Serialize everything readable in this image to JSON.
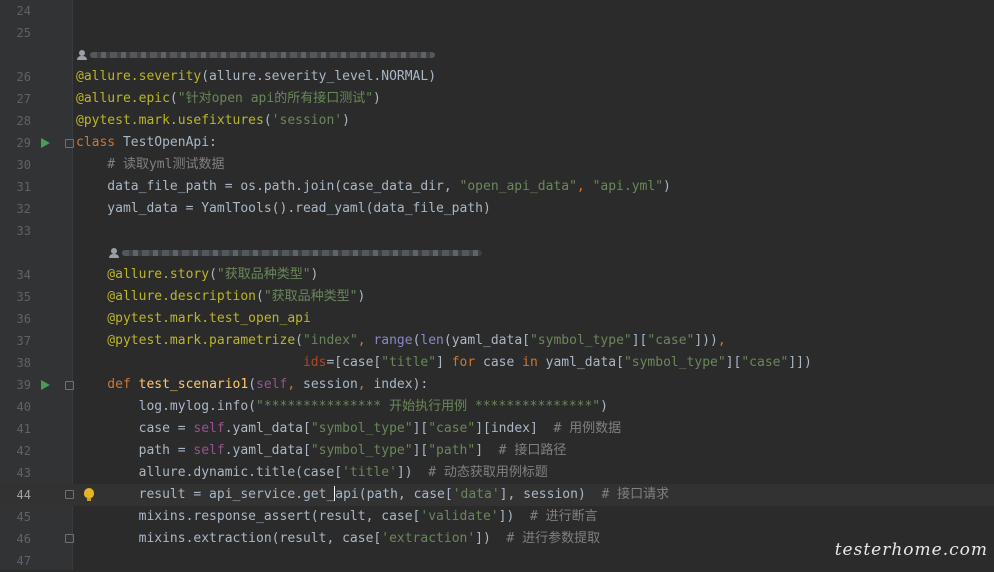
{
  "editor": {
    "lines": [
      {
        "num": "24",
        "tokens": []
      },
      {
        "num": "25",
        "tokens": []
      },
      {
        "num": "26",
        "tokens": [
          {
            "t": "@allure.severity",
            "c": "#bbb529"
          },
          {
            "t": "(allure.severity_level.NORMAL)",
            "c": "#a9b7c6"
          }
        ]
      },
      {
        "num": "27",
        "tokens": [
          {
            "t": "@allure.epic",
            "c": "#bbb529"
          },
          {
            "t": "(",
            "c": "#a9b7c6"
          },
          {
            "t": "\"针对open api的所有接口测试\"",
            "c": "#6a8759"
          },
          {
            "t": ")",
            "c": "#a9b7c6"
          }
        ]
      },
      {
        "num": "28",
        "tokens": [
          {
            "t": "@pytest.mark.usefixtures",
            "c": "#bbb529"
          },
          {
            "t": "(",
            "c": "#a9b7c6"
          },
          {
            "t": "'session'",
            "c": "#6a8759"
          },
          {
            "t": ")",
            "c": "#a9b7c6"
          }
        ]
      },
      {
        "num": "29",
        "tokens": [
          {
            "t": "class ",
            "c": "#cc7832"
          },
          {
            "t": "TestOpenApi:",
            "c": "#a9b7c6"
          }
        ]
      },
      {
        "num": "30",
        "tokens": [
          {
            "t": "    # 读取yml测试数据",
            "c": "#808080"
          }
        ]
      },
      {
        "num": "31",
        "tokens": [
          {
            "t": "    data_file_path = os.path.join(case_data_dir, ",
            "c": "#a9b7c6"
          },
          {
            "t": "\"open_api_data\"",
            "c": "#6a8759"
          },
          {
            "t": ", ",
            "c": "#cc7832"
          },
          {
            "t": "\"api.yml\"",
            "c": "#6a8759"
          },
          {
            "t": ")",
            "c": "#a9b7c6"
          }
        ]
      },
      {
        "num": "32",
        "tokens": [
          {
            "t": "    yaml_data = YamlTools().read_yaml(data_file_path)",
            "c": "#a9b7c6"
          }
        ]
      },
      {
        "num": "33",
        "tokens": []
      },
      {
        "num": "34",
        "tokens": [
          {
            "t": "    @allure.story",
            "c": "#bbb529"
          },
          {
            "t": "(",
            "c": "#a9b7c6"
          },
          {
            "t": "\"获取品种类型\"",
            "c": "#6a8759"
          },
          {
            "t": ")",
            "c": "#a9b7c6"
          }
        ]
      },
      {
        "num": "35",
        "tokens": [
          {
            "t": "    @allure.description",
            "c": "#bbb529"
          },
          {
            "t": "(",
            "c": "#a9b7c6"
          },
          {
            "t": "\"获取品种类型\"",
            "c": "#6a8759"
          },
          {
            "t": ")",
            "c": "#a9b7c6"
          }
        ]
      },
      {
        "num": "36",
        "tokens": [
          {
            "t": "    @pytest.mark.test_open_api",
            "c": "#bbb529"
          }
        ]
      },
      {
        "num": "37",
        "tokens": [
          {
            "t": "    @pytest.mark.parametrize",
            "c": "#bbb529"
          },
          {
            "t": "(",
            "c": "#a9b7c6"
          },
          {
            "t": "\"index\"",
            "c": "#6a8759"
          },
          {
            "t": ", ",
            "c": "#cc7832"
          },
          {
            "t": "range",
            "c": "#8888c6"
          },
          {
            "t": "(",
            "c": "#a9b7c6"
          },
          {
            "t": "len",
            "c": "#8888c6"
          },
          {
            "t": "(yaml_data[",
            "c": "#a9b7c6"
          },
          {
            "t": "\"symbol_type\"",
            "c": "#6a8759"
          },
          {
            "t": "][",
            "c": "#a9b7c6"
          },
          {
            "t": "\"case\"",
            "c": "#6a8759"
          },
          {
            "t": "]))",
            "c": "#a9b7c6"
          },
          {
            "t": ",",
            "c": "#cc7832"
          }
        ]
      },
      {
        "num": "38",
        "tokens": [
          {
            "t": "                             ",
            "c": "#a9b7c6"
          },
          {
            "t": "ids",
            "c": "#aa4926"
          },
          {
            "t": "=[case[",
            "c": "#a9b7c6"
          },
          {
            "t": "\"title\"",
            "c": "#6a8759"
          },
          {
            "t": "] ",
            "c": "#a9b7c6"
          },
          {
            "t": "for ",
            "c": "#cc7832"
          },
          {
            "t": "case ",
            "c": "#a9b7c6"
          },
          {
            "t": "in ",
            "c": "#cc7832"
          },
          {
            "t": "yaml_data[",
            "c": "#a9b7c6"
          },
          {
            "t": "\"symbol_type\"",
            "c": "#6a8759"
          },
          {
            "t": "][",
            "c": "#a9b7c6"
          },
          {
            "t": "\"case\"",
            "c": "#6a8759"
          },
          {
            "t": "]])",
            "c": "#a9b7c6"
          }
        ]
      },
      {
        "num": "39",
        "tokens": [
          {
            "t": "    def ",
            "c": "#cc7832"
          },
          {
            "t": "test_scenario1",
            "c": "#ffc66d"
          },
          {
            "t": "(",
            "c": "#a9b7c6"
          },
          {
            "t": "self",
            "c": "#94558d"
          },
          {
            "t": ", ",
            "c": "#cc7832"
          },
          {
            "t": "session",
            "c": "#a9b7c6"
          },
          {
            "t": ", ",
            "c": "#cc7832"
          },
          {
            "t": "index):",
            "c": "#a9b7c6"
          }
        ]
      },
      {
        "num": "40",
        "tokens": [
          {
            "t": "        log.mylog.info(",
            "c": "#a9b7c6"
          },
          {
            "t": "\"*************** 开始执行用例 ***************\"",
            "c": "#6a8759"
          },
          {
            "t": ")",
            "c": "#a9b7c6"
          }
        ]
      },
      {
        "num": "41",
        "tokens": [
          {
            "t": "        case = ",
            "c": "#a9b7c6"
          },
          {
            "t": "self",
            "c": "#94558d"
          },
          {
            "t": ".yaml_data[",
            "c": "#a9b7c6"
          },
          {
            "t": "\"symbol_type\"",
            "c": "#6a8759"
          },
          {
            "t": "][",
            "c": "#a9b7c6"
          },
          {
            "t": "\"case\"",
            "c": "#6a8759"
          },
          {
            "t": "][index]  ",
            "c": "#a9b7c6"
          },
          {
            "t": "# 用例数据",
            "c": "#808080"
          }
        ]
      },
      {
        "num": "42",
        "tokens": [
          {
            "t": "        path = ",
            "c": "#a9b7c6"
          },
          {
            "t": "self",
            "c": "#94558d"
          },
          {
            "t": ".yaml_data[",
            "c": "#a9b7c6"
          },
          {
            "t": "\"symbol_type\"",
            "c": "#6a8759"
          },
          {
            "t": "][",
            "c": "#a9b7c6"
          },
          {
            "t": "\"path\"",
            "c": "#6a8759"
          },
          {
            "t": "]  ",
            "c": "#a9b7c6"
          },
          {
            "t": "# 接口路径",
            "c": "#808080"
          }
        ]
      },
      {
        "num": "43",
        "tokens": [
          {
            "t": "        allure.dynamic.title(case[",
            "c": "#a9b7c6"
          },
          {
            "t": "'title'",
            "c": "#6a8759"
          },
          {
            "t": "])  ",
            "c": "#a9b7c6"
          },
          {
            "t": "# 动态获取用例标题",
            "c": "#808080"
          }
        ]
      },
      {
        "num": "44",
        "current": true,
        "tokens": [
          {
            "t": "        result = api_service.get_",
            "c": "#a9b7c6"
          },
          {
            "t": "CARET",
            "c": "#ffffff"
          },
          {
            "t": "api(path, ",
            "c": "#a9b7c6"
          },
          {
            "t": "case[",
            "c": "#a9b7c6"
          },
          {
            "t": "'data'",
            "c": "#6a8759"
          },
          {
            "t": "], ",
            "c": "#a9b7c6"
          },
          {
            "t": "session)  ",
            "c": "#a9b7c6"
          },
          {
            "t": "# 接口请求",
            "c": "#808080"
          }
        ]
      },
      {
        "num": "45",
        "tokens": [
          {
            "t": "        mixins.response_assert(result, case[",
            "c": "#a9b7c6"
          },
          {
            "t": "'validate'",
            "c": "#6a8759"
          },
          {
            "t": "])  ",
            "c": "#a9b7c6"
          },
          {
            "t": "# 进行断言",
            "c": "#808080"
          }
        ]
      },
      {
        "num": "46",
        "tokens": [
          {
            "t": "        mixins.extraction(result, case[",
            "c": "#a9b7c6"
          },
          {
            "t": "'extraction'",
            "c": "#6a8759"
          },
          {
            "t": "])  ",
            "c": "#a9b7c6"
          },
          {
            "t": "# 进行参数提取",
            "c": "#808080"
          }
        ]
      },
      {
        "num": "47",
        "tokens": []
      }
    ]
  },
  "watermark": "testerhome.com"
}
